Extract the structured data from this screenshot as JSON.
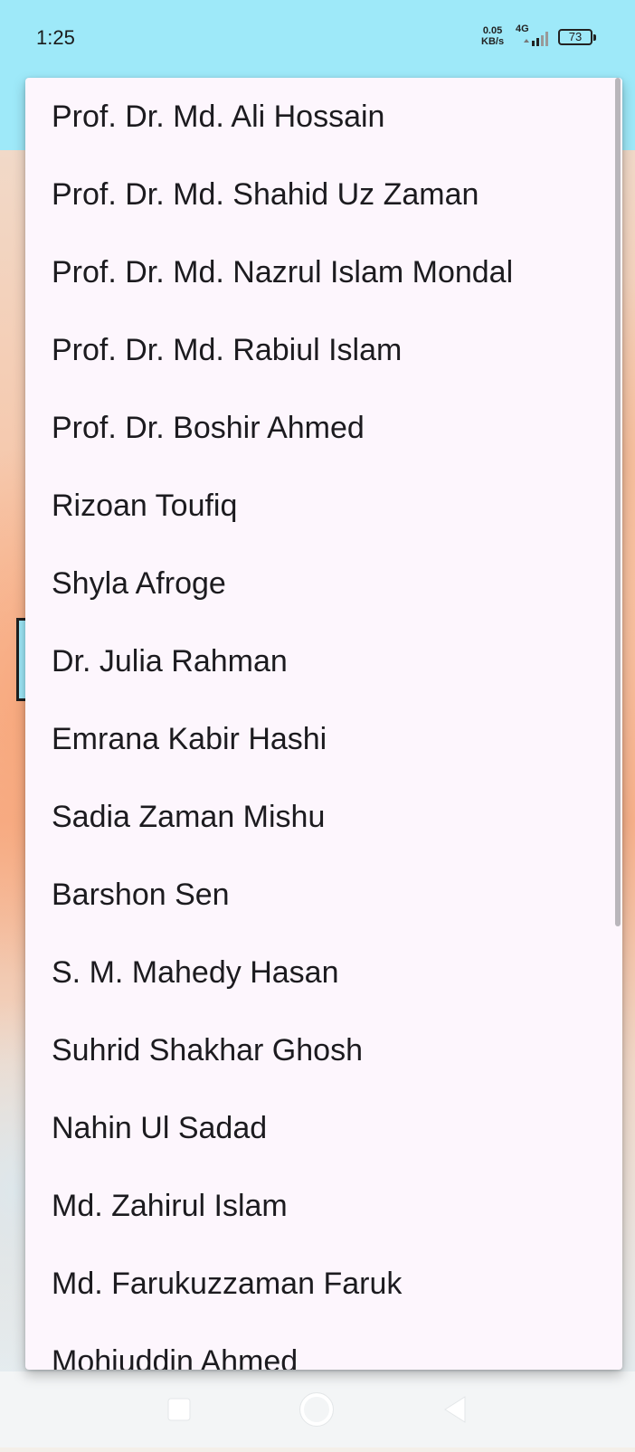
{
  "status_bar": {
    "time": "1:25",
    "net_speed_value": "0.05",
    "net_speed_unit": "KB/s",
    "network_type": "4G",
    "battery": "73"
  },
  "dropdown": {
    "items": [
      "Prof. Dr. Md. Ali Hossain",
      "Prof. Dr. Md. Shahid Uz Zaman",
      "Prof. Dr. Md. Nazrul Islam Mondal",
      "Prof. Dr. Md. Rabiul Islam",
      "Prof. Dr. Boshir Ahmed",
      "Rizoan Toufiq",
      "Shyla Afroge",
      "Dr. Julia Rahman",
      "Emrana Kabir Hashi",
      "Sadia Zaman Mishu",
      "Barshon Sen",
      "S. M. Mahedy Hasan",
      "Suhrid Shakhar Ghosh",
      "Nahin Ul Sadad",
      "Md. Zahirul Islam",
      "Md. Farukuzzaman Faruk",
      "Mohiuddin Ahmed"
    ]
  },
  "nav": {
    "recent_icon": "square-icon",
    "home_icon": "circle-icon",
    "back_icon": "triangle-back-icon"
  },
  "colors": {
    "app_bar": "#9ee9f9",
    "menu_surface": "#fdf6fd",
    "text": "#1c1b1f"
  }
}
